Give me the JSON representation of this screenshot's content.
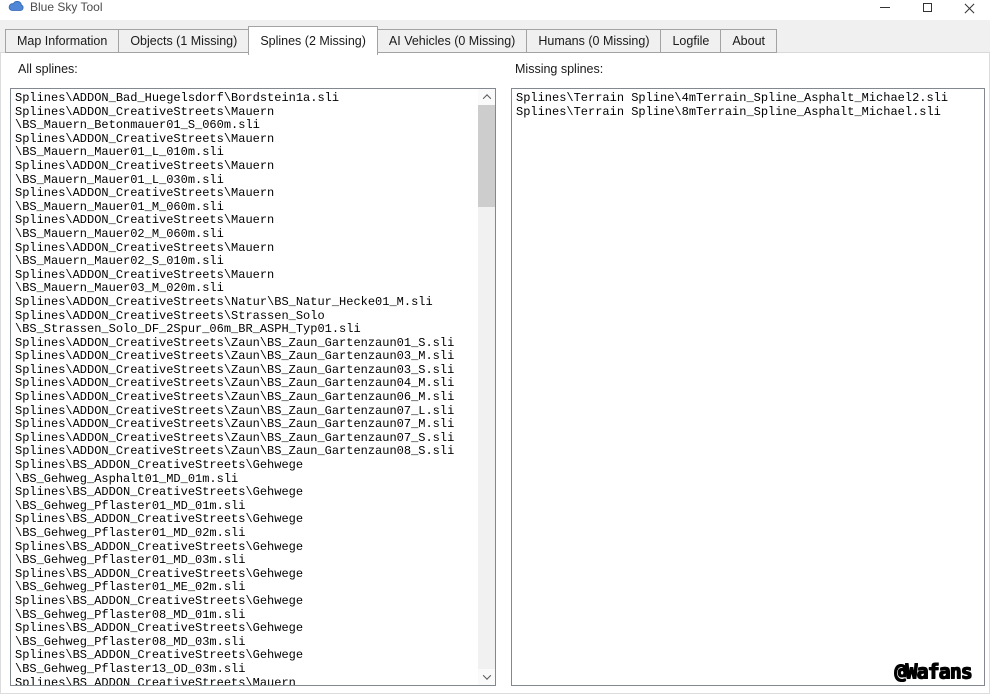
{
  "window": {
    "title": "Blue Sky Tool"
  },
  "icons": {
    "app": "blue-cloud",
    "minimize": "horizontal-line",
    "maximize": "square-outline",
    "close": "x-cross",
    "scroll_up": "chevron-up",
    "scroll_down": "chevron-down"
  },
  "colors": {
    "app_icon_blue": "#3f7fd1",
    "tab_background": "#f0f0f0",
    "tab_border": "#a3a3a3",
    "active_tab_background": "#ffffff",
    "listbox_border": "#828790",
    "scrollbar_track": "#f1f1f1",
    "scrollbar_thumb": "#cdcdcd",
    "text": "#000000"
  },
  "tabs": [
    {
      "id": "map-information",
      "label": "Map Information",
      "active": false
    },
    {
      "id": "objects",
      "label": "Objects (1 Missing)",
      "active": false
    },
    {
      "id": "splines",
      "label": "Splines (2 Missing)",
      "active": true
    },
    {
      "id": "ai-vehicles",
      "label": "AI Vehicles (0 Missing)",
      "active": false
    },
    {
      "id": "humans",
      "label": "Humans (0 Missing)",
      "active": false
    },
    {
      "id": "logfile",
      "label": "Logfile",
      "active": false
    },
    {
      "id": "about",
      "label": "About",
      "active": false
    }
  ],
  "panels": {
    "all_splines": {
      "label": "All splines:",
      "lines": [
        "Splines\\ADDON_Bad_Huegelsdorf\\Bordstein1a.sli",
        "Splines\\ADDON_CreativeStreets\\Mauern",
        "\\BS_Mauern_Betonmauer01_S_060m.sli",
        "Splines\\ADDON_CreativeStreets\\Mauern",
        "\\BS_Mauern_Mauer01_L_010m.sli",
        "Splines\\ADDON_CreativeStreets\\Mauern",
        "\\BS_Mauern_Mauer01_L_030m.sli",
        "Splines\\ADDON_CreativeStreets\\Mauern",
        "\\BS_Mauern_Mauer01_M_060m.sli",
        "Splines\\ADDON_CreativeStreets\\Mauern",
        "\\BS_Mauern_Mauer02_M_060m.sli",
        "Splines\\ADDON_CreativeStreets\\Mauern",
        "\\BS_Mauern_Mauer02_S_010m.sli",
        "Splines\\ADDON_CreativeStreets\\Mauern",
        "\\BS_Mauern_Mauer03_M_020m.sli",
        "Splines\\ADDON_CreativeStreets\\Natur\\BS_Natur_Hecke01_M.sli",
        "Splines\\ADDON_CreativeStreets\\Strassen_Solo",
        "\\BS_Strassen_Solo_DF_2Spur_06m_BR_ASPH_Typ01.sli",
        "Splines\\ADDON_CreativeStreets\\Zaun\\BS_Zaun_Gartenzaun01_S.sli",
        "Splines\\ADDON_CreativeStreets\\Zaun\\BS_Zaun_Gartenzaun03_M.sli",
        "Splines\\ADDON_CreativeStreets\\Zaun\\BS_Zaun_Gartenzaun03_S.sli",
        "Splines\\ADDON_CreativeStreets\\Zaun\\BS_Zaun_Gartenzaun04_M.sli",
        "Splines\\ADDON_CreativeStreets\\Zaun\\BS_Zaun_Gartenzaun06_M.sli",
        "Splines\\ADDON_CreativeStreets\\Zaun\\BS_Zaun_Gartenzaun07_L.sli",
        "Splines\\ADDON_CreativeStreets\\Zaun\\BS_Zaun_Gartenzaun07_M.sli",
        "Splines\\ADDON_CreativeStreets\\Zaun\\BS_Zaun_Gartenzaun07_S.sli",
        "Splines\\ADDON_CreativeStreets\\Zaun\\BS_Zaun_Gartenzaun08_S.sli",
        "Splines\\BS_ADDON_CreativeStreets\\Gehwege",
        "\\BS_Gehweg_Asphalt01_MD_01m.sli",
        "Splines\\BS_ADDON_CreativeStreets\\Gehwege",
        "\\BS_Gehweg_Pflaster01_MD_01m.sli",
        "Splines\\BS_ADDON_CreativeStreets\\Gehwege",
        "\\BS_Gehweg_Pflaster01_MD_02m.sli",
        "Splines\\BS_ADDON_CreativeStreets\\Gehwege",
        "\\BS_Gehweg_Pflaster01_MD_03m.sli",
        "Splines\\BS_ADDON_CreativeStreets\\Gehwege",
        "\\BS_Gehweg_Pflaster01_ME_02m.sli",
        "Splines\\BS_ADDON_CreativeStreets\\Gehwege",
        "\\BS_Gehweg_Pflaster08_MD_01m.sli",
        "Splines\\BS_ADDON_CreativeStreets\\Gehwege",
        "\\BS_Gehweg_Pflaster08_MD_03m.sli",
        "Splines\\BS_ADDON_CreativeStreets\\Gehwege",
        "\\BS_Gehweg_Pflaster13_OD_03m.sli",
        "Splines\\BS_ADDON_CreativeStreets\\Mauern"
      ]
    },
    "missing_splines": {
      "label": "Missing splines:",
      "lines": [
        "Splines\\Terrain Spline\\4mTerrain_Spline_Asphalt_Michael2.sli",
        "Splines\\Terrain Spline\\8mTerrain_Spline_Asphalt_Michael.sli"
      ]
    }
  },
  "watermark": "@Wafans"
}
